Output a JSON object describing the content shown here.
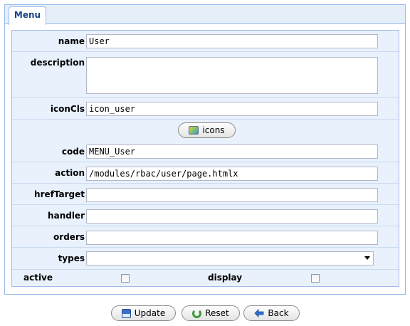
{
  "panel": {
    "tab_label": "Menu"
  },
  "form": {
    "name": {
      "label": "name",
      "value": "User"
    },
    "description": {
      "label": "description",
      "value": ""
    },
    "iconCls": {
      "label": "iconCls",
      "value": "icon_user"
    },
    "icons_button": {
      "label": "icons",
      "icon": "image-icon"
    },
    "code": {
      "label": "code",
      "value": "MENU_User"
    },
    "action": {
      "label": "action",
      "value": "/modules/rbac/user/page.htmlx"
    },
    "hrefTarget": {
      "label": "hrefTarget",
      "value": ""
    },
    "handler": {
      "label": "handler",
      "value": ""
    },
    "orders": {
      "label": "orders",
      "value": ""
    },
    "types": {
      "label": "types",
      "value": ""
    },
    "active": {
      "label": "active",
      "checked": false
    },
    "display": {
      "label": "display",
      "checked": false
    }
  },
  "buttons": {
    "update": {
      "label": "Update",
      "icon": "save-icon"
    },
    "reset": {
      "label": "Reset",
      "icon": "refresh-icon"
    },
    "back": {
      "label": "Back",
      "icon": "back-arrow-icon"
    }
  }
}
